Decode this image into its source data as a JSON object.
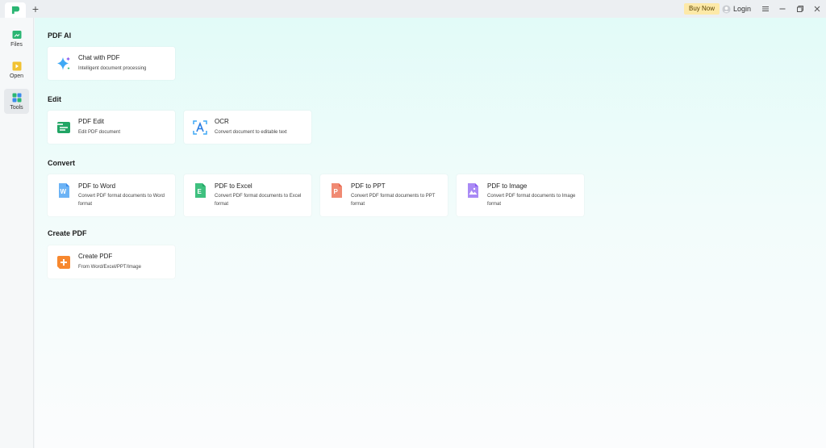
{
  "titlebar": {
    "new_tab_label": "+",
    "buy_now_label": "Buy Now",
    "login_label": "Login"
  },
  "sidebar": {
    "items": [
      {
        "label": "Files",
        "icon": "files-icon",
        "color": "#2bb673"
      },
      {
        "label": "Open",
        "icon": "open-icon",
        "color": "#f1c232"
      },
      {
        "label": "Tools",
        "icon": "tools-icon",
        "color": "#2bb673"
      }
    ]
  },
  "main": {
    "sections": {
      "pdf_ai": {
        "title": "PDF AI",
        "cards": [
          {
            "title": "Chat with PDF",
            "sub": "Intelligent document processing",
            "icon": "sparkle-icon"
          }
        ]
      },
      "edit": {
        "title": "Edit",
        "cards": [
          {
            "title": "PDF Edit",
            "sub": "Edit PDF document",
            "icon": "pdf-edit-icon"
          },
          {
            "title": "OCR",
            "sub": "Convert document to editable text",
            "icon": "ocr-icon"
          }
        ]
      },
      "convert": {
        "title": "Convert",
        "cards": [
          {
            "title": "PDF to Word",
            "sub": "Convert PDF format documents to Word format",
            "icon": "word-icon"
          },
          {
            "title": "PDF to Excel",
            "sub": "Convert PDF format documents to Excel format",
            "icon": "excel-icon"
          },
          {
            "title": "PDF to PPT",
            "sub": "Convert PDF format documents to PPT format",
            "icon": "ppt-icon"
          },
          {
            "title": "PDF to Image",
            "sub": "Convert PDF format documents to Image format",
            "icon": "image-icon"
          }
        ]
      },
      "create": {
        "title": "Create PDF",
        "cards": [
          {
            "title": "Create PDF",
            "sub": "From Word/Excel/PPT/Image",
            "icon": "create-pdf-icon"
          }
        ]
      }
    }
  },
  "colors": {
    "accent_green": "#2bb673",
    "buy_now_bg": "#fde9a8",
    "word_blue": "#3b8beb",
    "excel_green": "#22a565",
    "ppt_red": "#e8634a",
    "image_purple": "#8a5cf0",
    "create_orange": "#f7882f"
  }
}
